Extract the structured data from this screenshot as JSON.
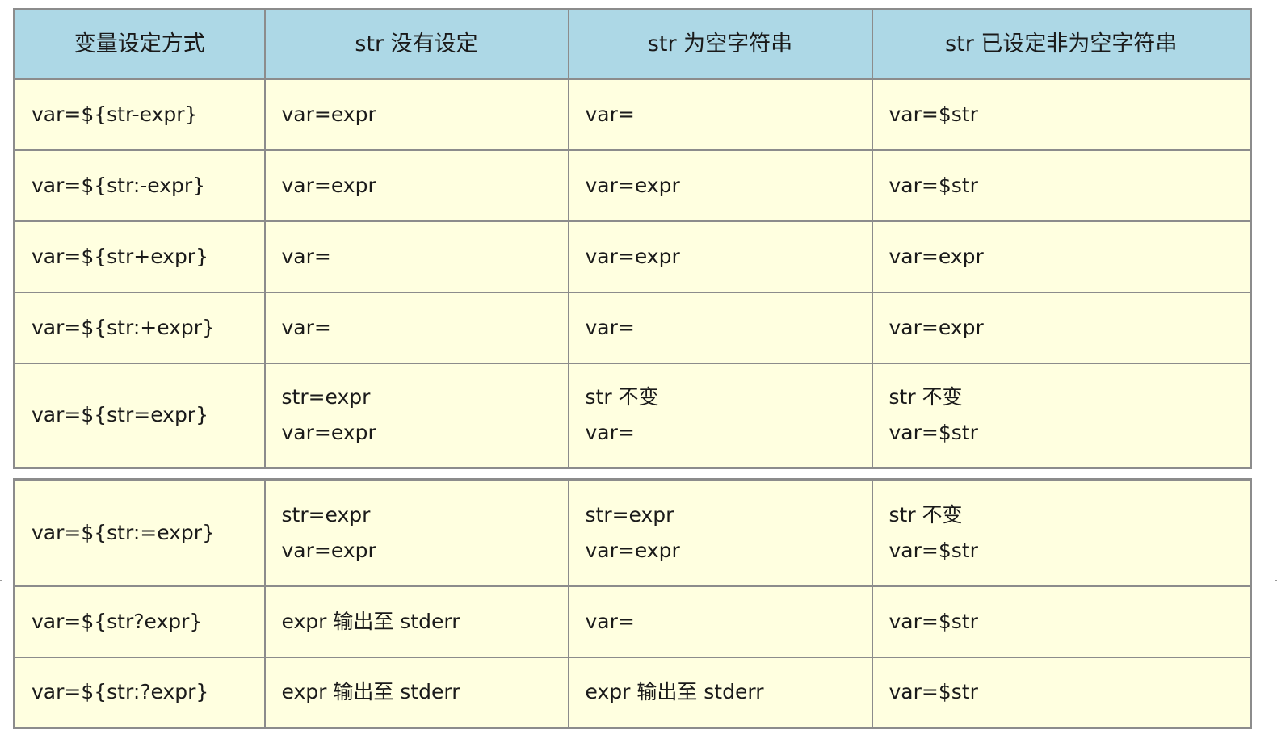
{
  "header": [
    "变量设定方式",
    "str  没有设定",
    "str  为空字符串",
    "str  已设定非为空字符串"
  ],
  "rows_top": [
    {
      "method": "var=${str-expr}",
      "unset": [
        "var=expr"
      ],
      "empty": [
        "var="
      ],
      "nonempty": [
        "var=$str"
      ]
    },
    {
      "method": "var=${str:-expr}",
      "unset": [
        "var=expr"
      ],
      "empty": [
        "var=expr"
      ],
      "nonempty": [
        "var=$str"
      ]
    },
    {
      "method": "var=${str+expr}",
      "unset": [
        "var="
      ],
      "empty": [
        "var=expr"
      ],
      "nonempty": [
        "var=expr"
      ]
    },
    {
      "method": "var=${str:+expr}",
      "unset": [
        "var="
      ],
      "empty": [
        "var="
      ],
      "nonempty": [
        "var=expr"
      ]
    },
    {
      "method": "var=${str=expr}",
      "unset": [
        "str=expr",
        "var=expr"
      ],
      "empty": [
        "str  不变",
        "var="
      ],
      "nonempty": [
        "str  不变",
        "var=$str"
      ]
    }
  ],
  "rows_bottom": [
    {
      "method": "var=${str:=expr}",
      "unset": [
        "str=expr",
        "var=expr"
      ],
      "empty": [
        "str=expr",
        "var=expr"
      ],
      "nonempty": [
        "str  不变",
        "var=$str"
      ]
    },
    {
      "method": "var=${str?expr}",
      "unset": [
        "expr  输出至  stderr"
      ],
      "empty": [
        "var="
      ],
      "nonempty": [
        "var=$str"
      ]
    },
    {
      "method": "var=${str:?expr}",
      "unset": [
        "expr  输出至  stderr"
      ],
      "empty": [
        "expr  输出至  stderr"
      ],
      "nonempty": [
        "var=$str"
      ]
    }
  ]
}
